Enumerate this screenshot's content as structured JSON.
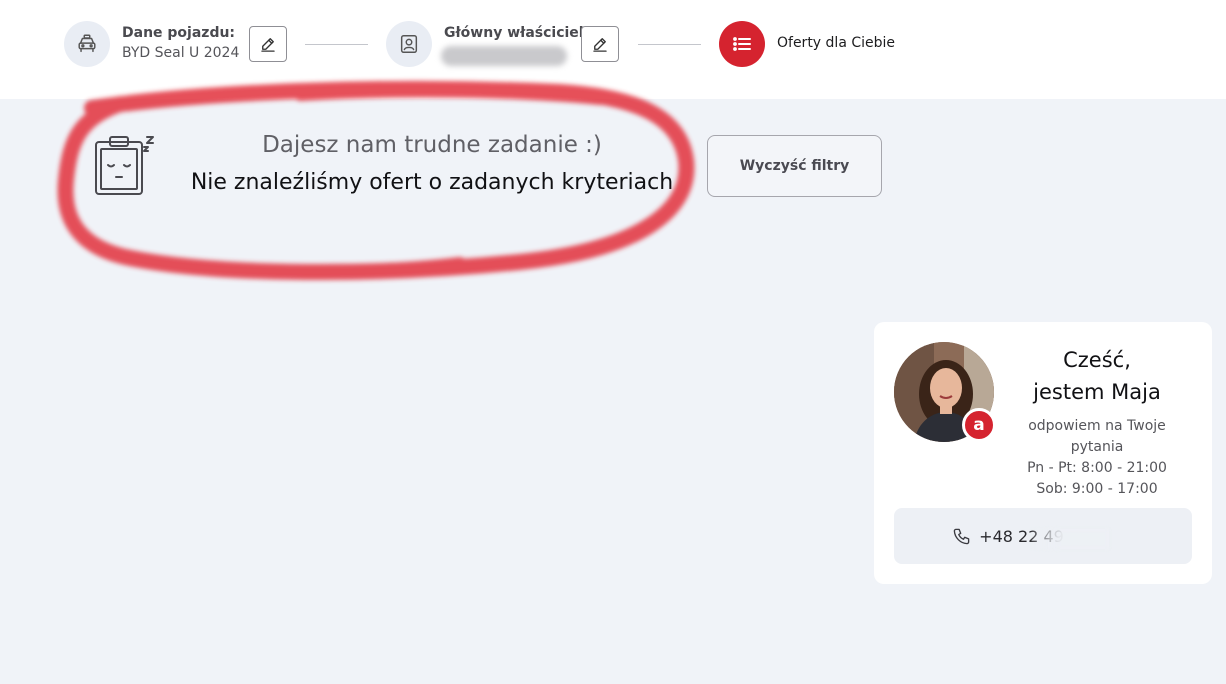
{
  "progress": {
    "vehicle_step": {
      "title": "Dane pojazdu:",
      "value": "BYD Seal U 2024",
      "icon": "car-icon"
    },
    "owner_step": {
      "title": "Główny właściciel:",
      "icon": "id-card-icon"
    },
    "offers_step": {
      "label": "Oferty dla Ciebie",
      "icon": "list-icon"
    },
    "accent_color": "#d5232f"
  },
  "empty_state": {
    "subtitle": "Dajesz nam trudne zadanie :)",
    "message": "Nie znaleźliśmy ofert o zadanych kryteriach",
    "clear_button": "Wyczyść filtry"
  },
  "agent": {
    "greeting_line1": "Cześć,",
    "greeting_line2": "jestem Maja",
    "availability": "odpowiem na Twoje pytania",
    "hours_weekdays": "Pn - Pt: 8:00 - 21:00",
    "hours_saturday": "Sob: 9:00 - 17:00",
    "phone": "+48 22 49",
    "badge": "a"
  }
}
